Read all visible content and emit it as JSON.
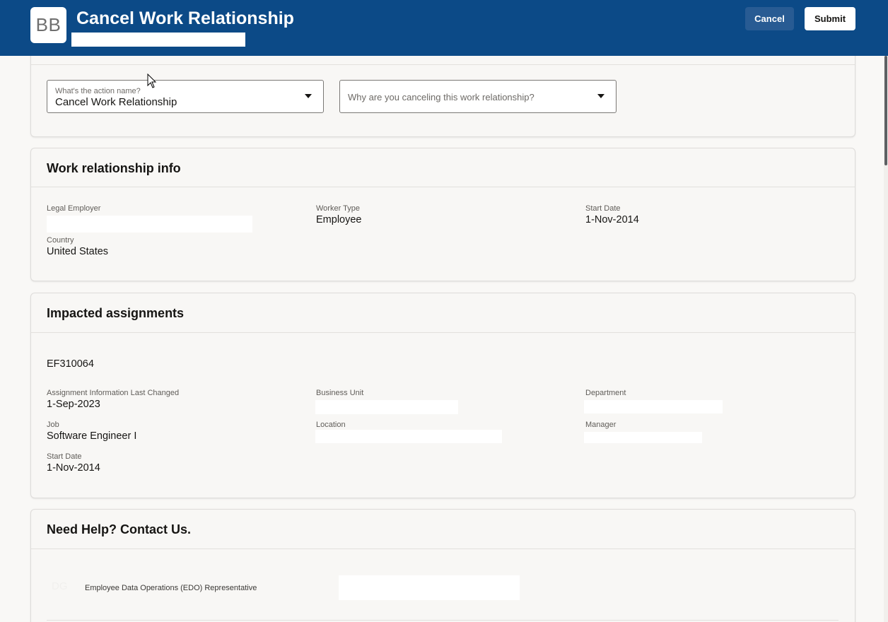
{
  "header": {
    "avatar_initials": "BB",
    "title": "Cancel Work Relationship",
    "cancel_label": "Cancel",
    "submit_label": "Submit"
  },
  "action": {
    "action_name_label": "What's the action name?",
    "action_name_value": "Cancel Work Relationship",
    "reason_placeholder": "Why are you canceling this work relationship?"
  },
  "work_relationship": {
    "title": "Work relationship info",
    "legal_employer_label": "Legal Employer",
    "worker_type_label": "Worker Type",
    "worker_type_value": "Employee",
    "start_date_label": "Start Date",
    "start_date_value": "1-Nov-2014",
    "country_label": "Country",
    "country_value": "United States"
  },
  "assignments": {
    "title": "Impacted assignments",
    "assignment_number": "EF310064",
    "last_changed_label": "Assignment Information Last Changed",
    "last_changed_value": "1-Sep-2023",
    "business_unit_label": "Business Unit",
    "department_label": "Department",
    "job_label": "Job",
    "job_value": "Software Engineer I",
    "location_label": "Location",
    "manager_label": "Manager",
    "start_date_label": "Start Date",
    "start_date_value": "1-Nov-2014"
  },
  "help": {
    "title": "Need Help? Contact Us.",
    "contact_initials": "DG",
    "contact_role": "Employee Data Operations (EDO) Representative"
  }
}
